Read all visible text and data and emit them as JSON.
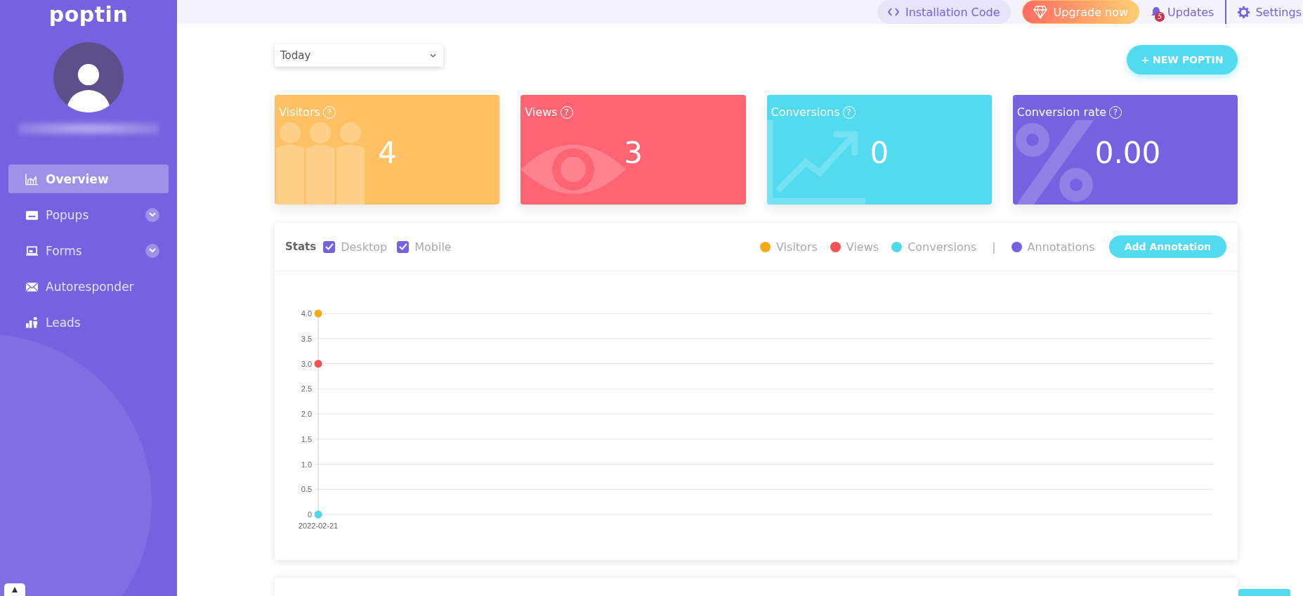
{
  "sidebar": {
    "logo": "poptin",
    "items": [
      {
        "label": "Overview",
        "kind": "chart",
        "selected": true,
        "expandable": false
      },
      {
        "label": "Popups",
        "kind": "popup",
        "selected": false,
        "expandable": true
      },
      {
        "label": "Forms",
        "kind": "form",
        "selected": false,
        "expandable": true
      },
      {
        "label": "Autoresponder",
        "kind": "mail",
        "selected": false,
        "expandable": false
      },
      {
        "label": "Leads",
        "kind": "leads",
        "selected": false,
        "expandable": false
      }
    ]
  },
  "top_bar": {
    "installation_code": "Installation Code",
    "upgrade": "Upgrade now",
    "updates": {
      "label": "Updates",
      "badge": "5"
    },
    "settings": "Settings"
  },
  "date_filter": {
    "value": "Today"
  },
  "new_button": "+ NEW POPTIN",
  "cards": [
    {
      "kind": "visitors",
      "title": "Visitors",
      "help": "?",
      "value": "4",
      "color": "#ffc163"
    },
    {
      "kind": "views",
      "title": "Views",
      "help": "?",
      "value": "3",
      "color": "#ff6473"
    },
    {
      "kind": "conversions",
      "title": "Conversions",
      "help": "?",
      "value": "0",
      "color": "#52dbef"
    },
    {
      "kind": "rate",
      "title": "Conversion rate",
      "help": "?",
      "value": "0.00",
      "color": "#7662e0"
    }
  ],
  "stats": {
    "title": "Stats",
    "filters": [
      {
        "label": "Desktop",
        "checked": true
      },
      {
        "label": "Mobile",
        "checked": true
      }
    ],
    "separator": "|",
    "annotations": {
      "label": "Annotations",
      "color": "#7662e0"
    },
    "add_button": "Add Annotation",
    "chart_data": {
      "type": "scatter",
      "grid": true,
      "categories": [
        "2022-02-21"
      ],
      "ylim": [
        0,
        4
      ],
      "yticks": [
        0,
        {
          "value": 0.5,
          "label": "0.5"
        },
        {
          "value": 1,
          "label": "1.0"
        },
        {
          "value": 1.5,
          "label": "1.5"
        },
        {
          "value": 2,
          "label": "2.0"
        },
        {
          "value": 2.5,
          "label": "2.5"
        },
        {
          "value": 3,
          "label": "3.0"
        },
        {
          "value": 3.5,
          "label": "3.5"
        },
        {
          "value": 4,
          "label": "4.0"
        }
      ],
      "series": [
        {
          "name": "Visitors",
          "color": "#f5ab18",
          "values": [
            4
          ]
        },
        {
          "name": "Views",
          "color": "#f05353",
          "values": [
            3
          ]
        },
        {
          "name": "Conversions",
          "color": "#4fd8ea",
          "values": [
            0
          ]
        }
      ]
    }
  }
}
